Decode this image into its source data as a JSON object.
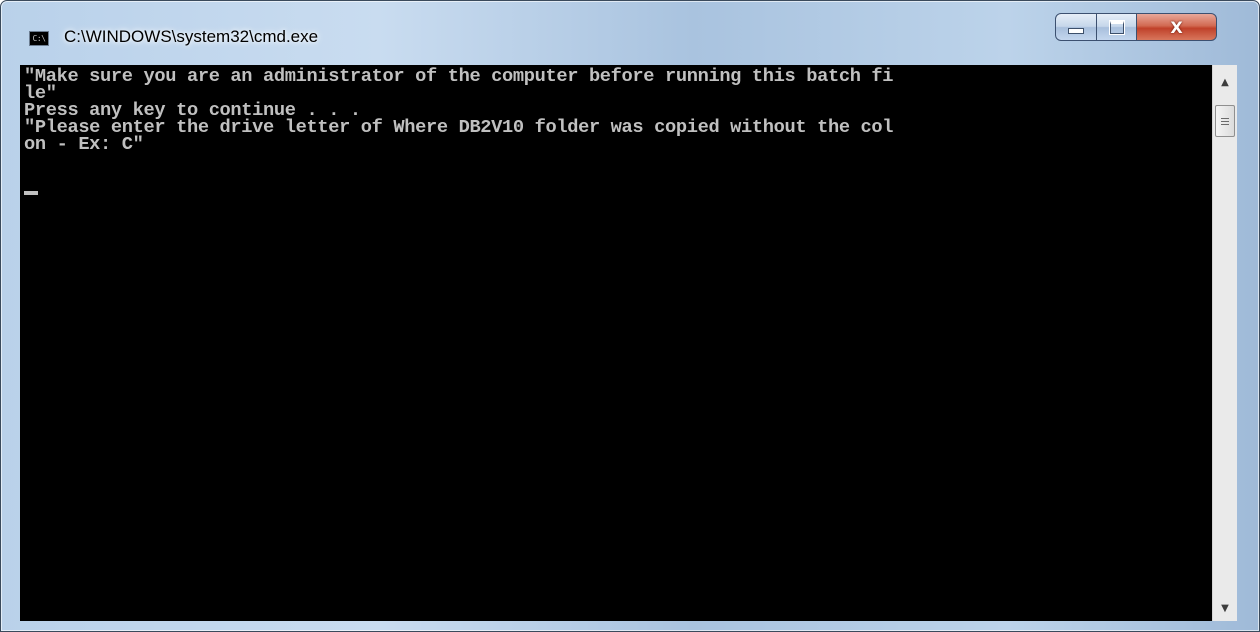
{
  "window": {
    "title": "C:\\WINDOWS\\system32\\cmd.exe",
    "icon_label": "C:\\"
  },
  "controls": {
    "minimize_icon": "minimize-icon",
    "maximize_icon": "maximize-icon",
    "close_label": "X"
  },
  "console": {
    "lines": [
      "\"Make sure you are an administrator of the computer before running this batch fi",
      "le\"",
      "Press any key to continue . . .",
      "\"Please enter the drive letter of Where DB2V10 folder was copied without the col",
      "on - Ex: C\""
    ],
    "text": "\"Make sure you are an administrator of the computer before running this batch fi\nle\"\nPress any key to continue . . .\n\"Please enter the drive letter of Where DB2V10 folder was copied without the col\non - Ex: C\""
  },
  "scrollbar": {
    "up_icon": "scroll-up-arrow-icon",
    "down_icon": "scroll-down-arrow-icon"
  },
  "colors": {
    "console_background": "#000000",
    "console_text": "#c0c0c0",
    "close_button": "#c0412a"
  }
}
